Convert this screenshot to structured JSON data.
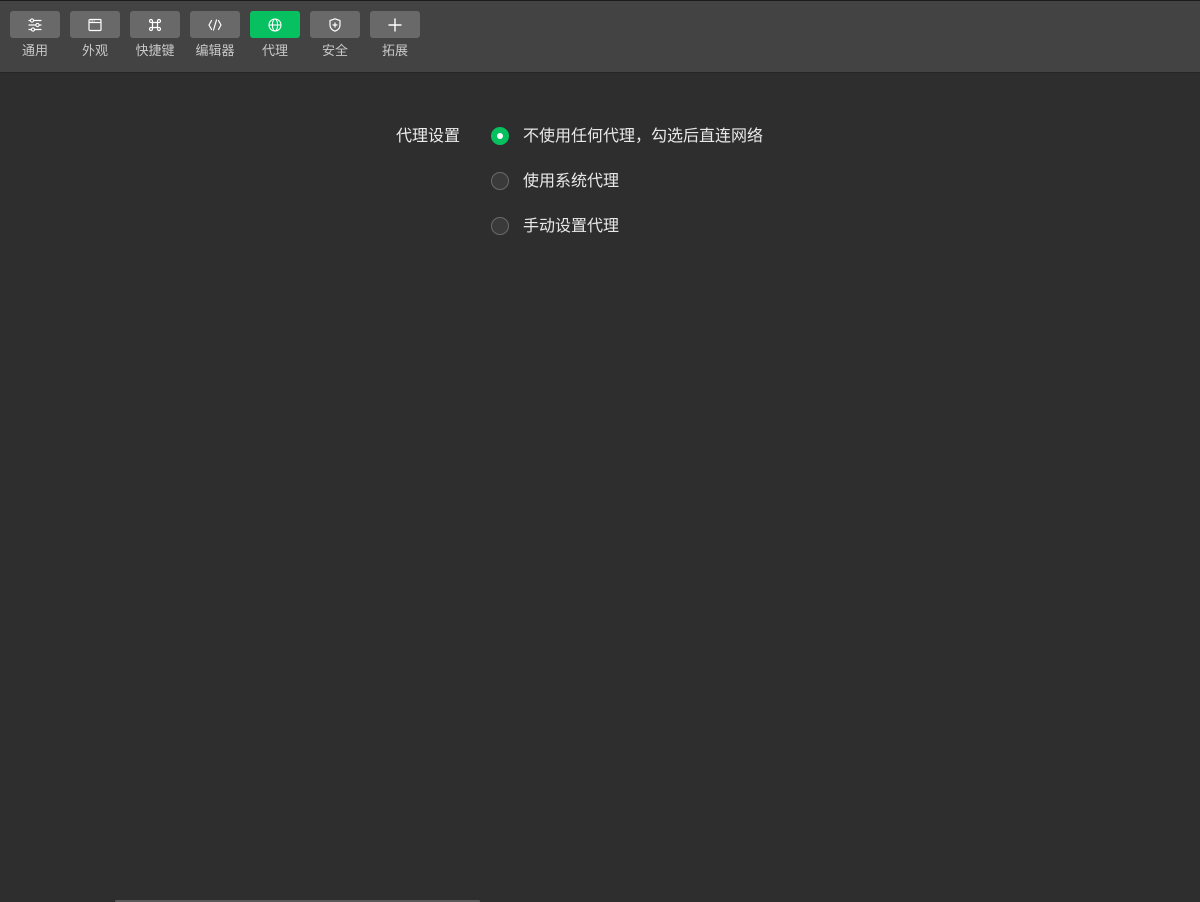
{
  "toolbar": {
    "tabs": [
      {
        "label": "通用",
        "icon": "sliders-icon"
      },
      {
        "label": "外观",
        "icon": "window-icon"
      },
      {
        "label": "快捷键",
        "icon": "command-key-icon"
      },
      {
        "label": "编辑器",
        "icon": "code-brackets-icon"
      },
      {
        "label": "代理",
        "icon": "globe-icon",
        "active": true
      },
      {
        "label": "安全",
        "icon": "shield-icon"
      },
      {
        "label": "拓展",
        "icon": "plus-icon"
      }
    ],
    "active_color": "#07c160"
  },
  "proxy": {
    "label": "代理设置",
    "options": [
      {
        "label": "不使用任何代理，勾选后直连网络",
        "checked": true
      },
      {
        "label": "使用系统代理",
        "checked": false
      },
      {
        "label": "手动设置代理",
        "checked": false
      }
    ]
  }
}
